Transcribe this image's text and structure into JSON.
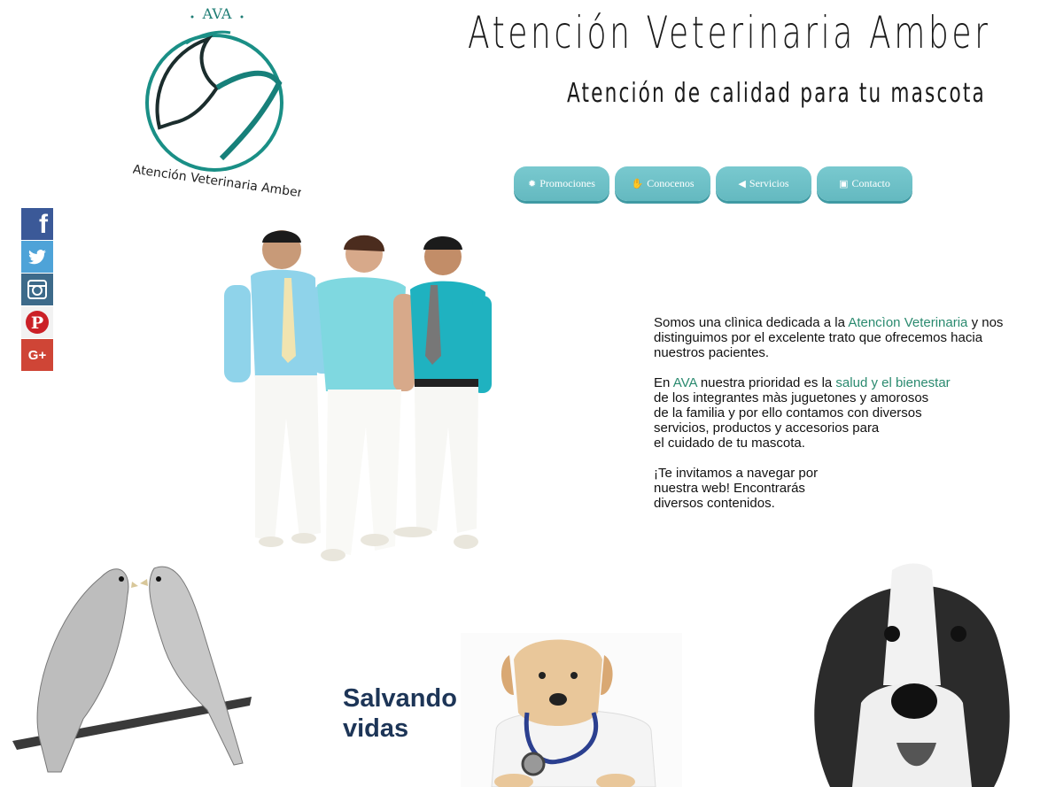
{
  "logo": {
    "text": "AVA",
    "caption": "Atención Veterinaria Amber"
  },
  "header": {
    "title": "Atención Veterinaria Amber",
    "subtitle": "Atención de calidad para tu mascota"
  },
  "nav": [
    {
      "label": "Promociones",
      "icon": "gear-icon"
    },
    {
      "label": "Conocenos",
      "icon": "hand-icon"
    },
    {
      "label": "Servicios",
      "icon": "megaphone-icon"
    },
    {
      "label": "Contacto",
      "icon": "id-card-icon"
    }
  ],
  "social": [
    {
      "name": "facebook",
      "glyph": "f"
    },
    {
      "name": "twitter",
      "glyph": "🐦"
    },
    {
      "name": "instagram",
      "glyph": "◙"
    },
    {
      "name": "pinterest",
      "glyph": "P"
    },
    {
      "name": "google-plus",
      "glyph": "G+"
    }
  ],
  "intro": {
    "p1_a": "Somos una clìnica dedicada a la ",
    "p1_hl": "Atencìon Veterinaria",
    "p1_b": " y nos distinguimos por el excelente trato que ofrecemos hacia nuestros pacientes.",
    "p2_a": "En ",
    "p2_hl1": "AVA",
    "p2_b": " nuestra prioridad es la ",
    "p2_hl2": "salud y el bienestar",
    "p2_c1": "de los integrantes màs juguetones y amorosos",
    "p2_c2": "de la familia y por ello contamos con diversos",
    "p2_c3": "servicios, productos y accesorios para",
    "p2_c4": "el cuidado de tu mascota.",
    "p3_1": "¡Te invitamos a navegar por",
    "p3_2": "nuestra web! Encontrarás",
    "p3_3": "diversos contenidos."
  },
  "tagline": {
    "line1": "Salvando",
    "line2": "vidas"
  },
  "colors": {
    "teal": "#64b9c0",
    "highlight": "#2a8a6f",
    "tagline": "#1d3557"
  }
}
